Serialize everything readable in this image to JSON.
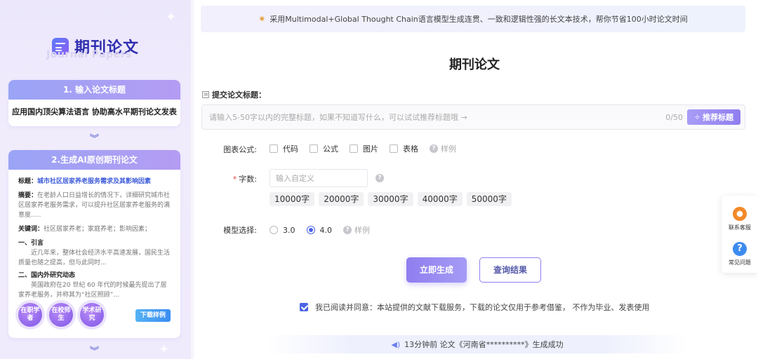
{
  "sidebar": {
    "brand_title": "期刊论文",
    "brand_subtitle": "Journal Papers",
    "step1": {
      "header": "1. 输入论文标题",
      "text": "应用国内顶尖算法语言 协助高水平期刊论文发表"
    },
    "step2": {
      "header": "2.生成AI原创期刊论文",
      "title_label": "标题：",
      "title_value": "城市社区居家养老服务需求及其影响因素",
      "abstract_label": "摘要：",
      "abstract_text": "在老龄人口日益增长的情况下，详细研究城市社区居家养老服务需求，可以提升社区居家养老服务的满意度.....",
      "keywords_label": "关键词：",
      "keywords_text": "社区居家养老；家庭养老；影响因素；",
      "section1_title": "一、引言",
      "section1_text": "近几年来，整体社会经济水平高速发展，国民生活质量也随之提高，但与此同时...",
      "section2_title": "二、国内外研究动态",
      "section2_text": "英国政府在20 世纪 60 年代的时候最先提出了居家养老服务，并称其为“社区照顾”...",
      "badges": [
        "在职学者",
        "在校师生",
        "学术研究"
      ],
      "download_label": "下载样例"
    }
  },
  "banner": {
    "text": "采用Multimodal+Global Thought Chain语言模型生成连贯、一致和逻辑性强的长文本技术，帮你节省100小时论文时间"
  },
  "main": {
    "page_title": "期刊论文",
    "title_field_label": "提交论文标题：",
    "title_placeholder": "请输入5-50字以内的完整标题，如果不知道写什么，可以试试推荐标题哦 →",
    "title_counter": "0/50",
    "recommend_label": "推荐标题",
    "charts_label": "图表公式:",
    "charts_options": [
      "代码",
      "公式",
      "图片",
      "表格"
    ],
    "sample_label": "样例",
    "wordcount_label": "字数:",
    "wordcount_placeholder": "输入自定义",
    "wordcount_presets": [
      "10000字",
      "20000字",
      "30000字",
      "40000字",
      "50000字"
    ],
    "model_label": "模型选择:",
    "model_options": [
      "3.0",
      "4.0"
    ],
    "model_selected": "4.0",
    "generate_label": "立即生成",
    "query_label": "查询结果",
    "agreement_text": "我已阅读并同意：本站提供的文献下载服务，下载的论文仅用于参考借鉴， 不作为毕业、发表使用",
    "notice_text": "13分钟前 论文《河南省**********》生成成功"
  },
  "float_panel": {
    "service_label": "联系客服",
    "faq_label": "常见问题"
  },
  "colors": {
    "accent": "#8f7ef0",
    "primary_blue": "#4b63e8"
  }
}
